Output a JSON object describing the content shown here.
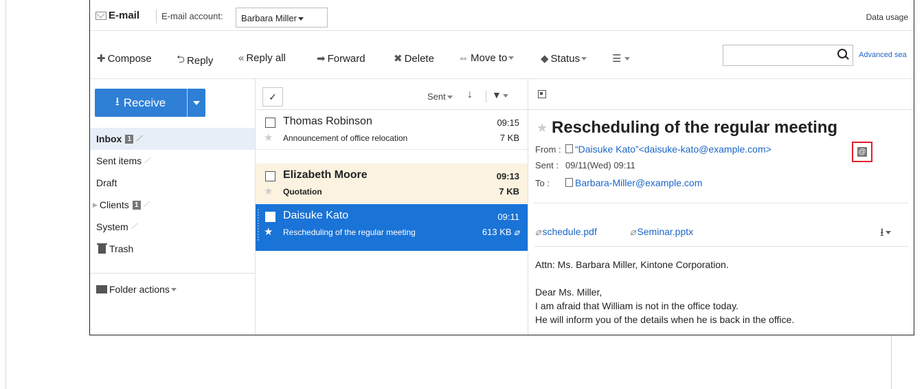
{
  "app": {
    "title": "E-mail",
    "account_label": "E-mail account:",
    "account_value": "Barbara Miller",
    "data_usage": "Data usage"
  },
  "toolbar": {
    "compose": "Compose",
    "reply": "Reply",
    "reply_all": "Reply all",
    "forward": "Forward",
    "delete": "Delete",
    "move_to": "Move to",
    "status": "Status",
    "search_value": "",
    "advanced_search": "Advanced sea"
  },
  "sidebar": {
    "receive": "Receive",
    "folders": [
      {
        "label": "Inbox",
        "badge": "1"
      },
      {
        "label": "Sent items"
      },
      {
        "label": "Draft"
      },
      {
        "label": "Clients",
        "badge": "1"
      },
      {
        "label": "System"
      },
      {
        "label": "Trash"
      }
    ],
    "folder_actions": "Folder actions"
  },
  "list": {
    "sort_label": "Sent",
    "messages": [
      {
        "sender": "Thomas Robinson",
        "time": "09:15",
        "subject": "Announcement of office relocation",
        "size": "7 KB"
      },
      {
        "sender": "Elizabeth Moore",
        "time": "09:13",
        "subject": "Quotation",
        "size": "7 KB"
      },
      {
        "sender": "Daisuke Kato",
        "time": "09:11",
        "subject": "Rescheduling of the regular meeting",
        "size": "613 KB"
      }
    ]
  },
  "mail": {
    "subject": "Rescheduling of the regular meeting",
    "from_label": "From",
    "from_value": "“Daisuke Kato”<daisuke-kato@example.com>",
    "sent_label": "Sent",
    "sent_value": "09/11(Wed) 09:11",
    "to_label": "To",
    "to_value": "Barbara-Miller@example.com",
    "attachments": [
      "schedule.pdf",
      "Seminar.pptx"
    ],
    "body": [
      "Attn: Ms. Barbara Miller, Kintone Corporation.",
      "Dear Ms. Miller,",
      "I am afraid that William is not in the office today.",
      "He will inform you of the details when he is back in the office."
    ]
  },
  "colors": {
    "accent": "#2e7fd6",
    "selected_row": "#1a73d6",
    "unread_row": "#fbf3e0",
    "link": "#1a66c8",
    "callout": "#e0202a"
  }
}
